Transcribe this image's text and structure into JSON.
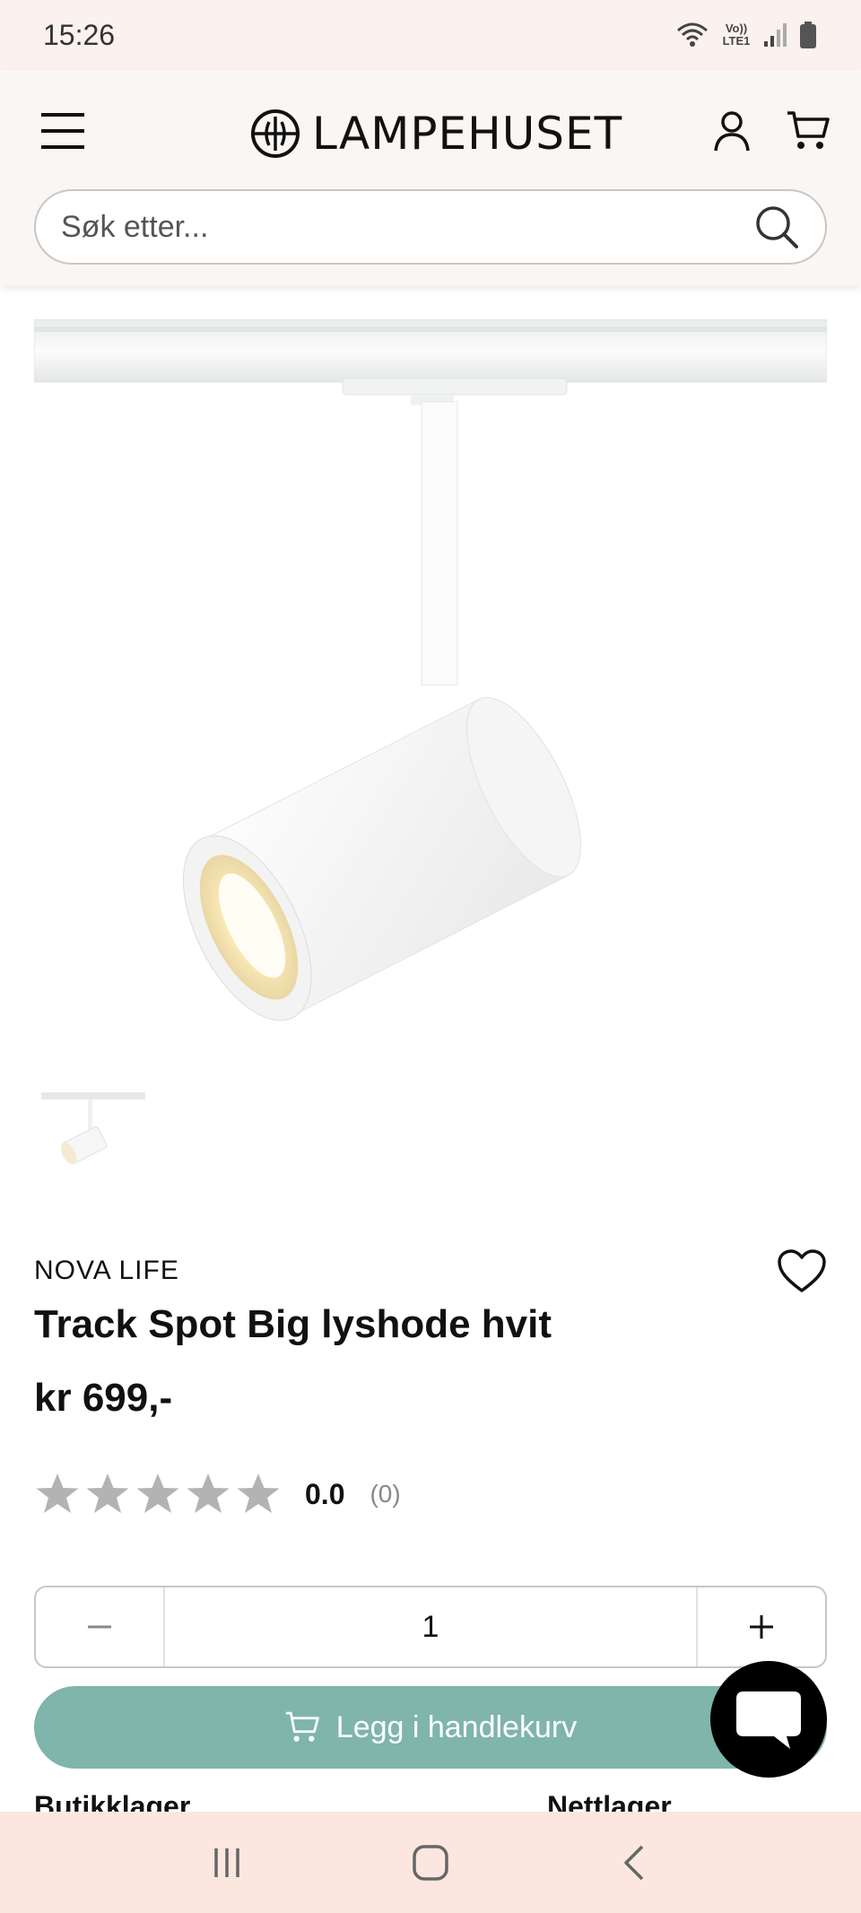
{
  "status_bar": {
    "time": "15:26",
    "network_label": "Vo)) LTE1",
    "icons": [
      "wifi-icon",
      "lte-icon",
      "signal-icon",
      "battery-icon"
    ]
  },
  "header": {
    "logo_text": "LAMPEHUSET",
    "icons": [
      "menu-icon",
      "account-icon",
      "cart-icon"
    ],
    "search": {
      "placeholder": "Søk etter..."
    }
  },
  "product": {
    "brand": "NOVA LIFE",
    "title": "Track Spot Big lyshode hvit",
    "price": "kr 699,-",
    "rating": {
      "score": "0.0",
      "count": "(0)",
      "stars": 0
    },
    "quantity": {
      "value": "1",
      "minus": "−",
      "plus": "+"
    },
    "add_to_cart_label": "Legg i handlekurv",
    "stock": {
      "store": "Butikklager",
      "online": "Nettlager"
    }
  },
  "colors": {
    "accent": "#7fb5ab",
    "header_bg": "#f9f6f3",
    "status_bg": "#fbf1ef",
    "nav_bg": "#fbe7df",
    "star": "#b3b3b3"
  }
}
